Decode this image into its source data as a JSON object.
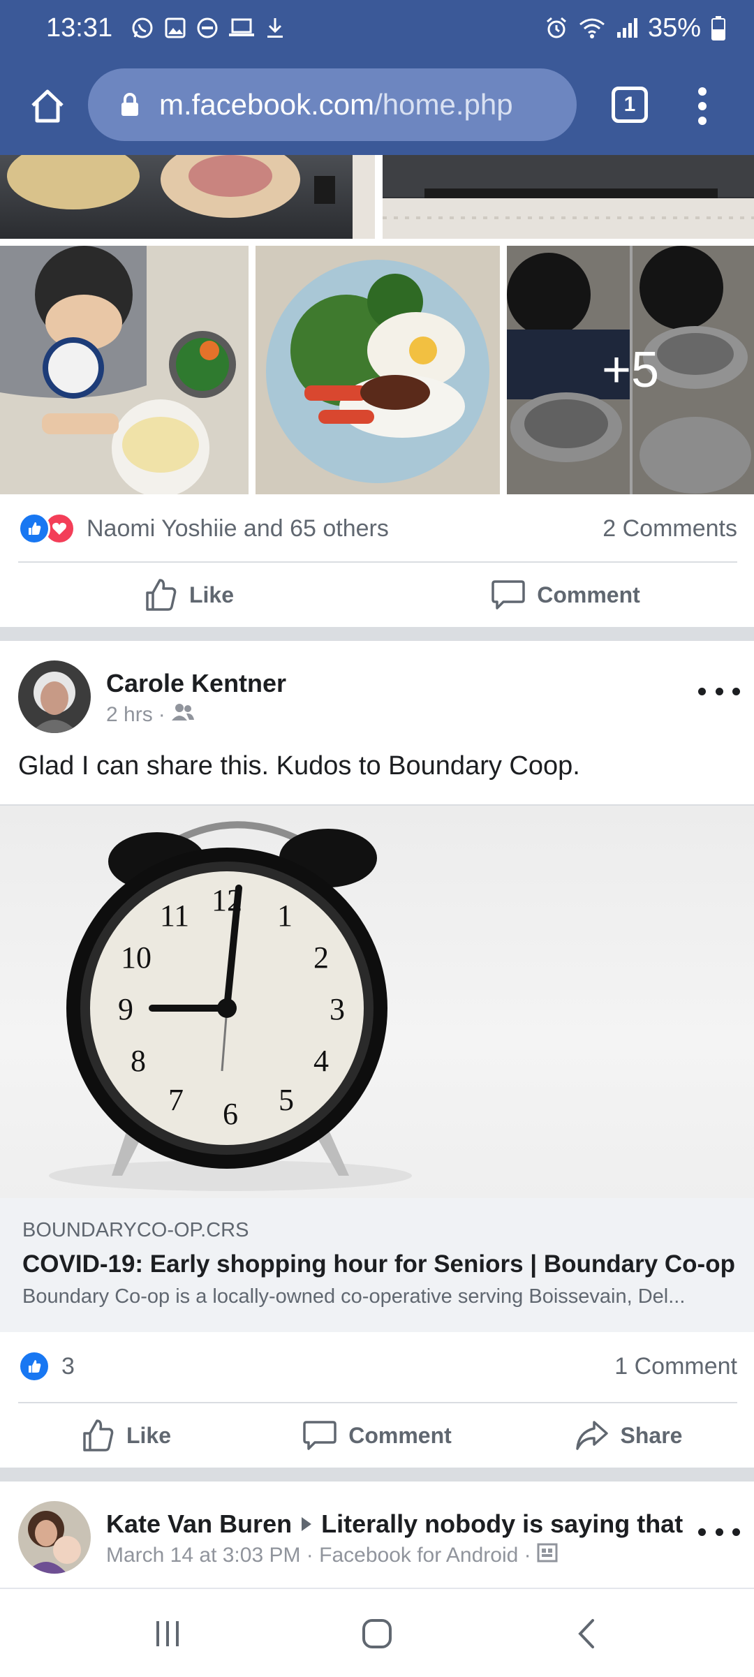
{
  "status_bar": {
    "time": "13:31",
    "battery": "35%",
    "left_icons": [
      "whatsapp-icon",
      "image-icon",
      "dnd-icon",
      "laptop-icon",
      "download-icon"
    ],
    "right_icons": [
      "alarm-icon",
      "wifi-icon",
      "signal-icon",
      "battery-icon"
    ]
  },
  "browser": {
    "url_host": "m.facebook.com",
    "url_path": "/home.php",
    "tab_count": "1"
  },
  "post1": {
    "more_photos": "+5",
    "reactions_text": "Naomi Yoshiie and 65 others",
    "comments": "2 Comments",
    "like_label": "Like",
    "comment_label": "Comment"
  },
  "post2": {
    "author": "Carole Kentner",
    "time": "2 hrs",
    "audience_icon": "friends-icon",
    "text": "Glad I can share this. Kudos to Boundary Coop.",
    "link": {
      "domain": "BOUNDARYCO-OP.CRS",
      "title": "COVID-19: Early shopping hour for Seniors | Boundary Co-op",
      "description": "Boundary Co-op is a locally-owned co-operative serving Boissevain, Del..."
    },
    "likes": "3",
    "comments": "1 Comment",
    "like_label": "Like",
    "comment_label": "Comment",
    "share_label": "Share"
  },
  "post3": {
    "author": "Kate Van Buren",
    "target": "Literally nobody is saying that",
    "meta": "March 14 at 3:03 PM · Facebook for Android ·"
  },
  "colors": {
    "brand_blue": "#3b5998",
    "like_blue": "#1877f2",
    "love_red": "#f33e58"
  }
}
